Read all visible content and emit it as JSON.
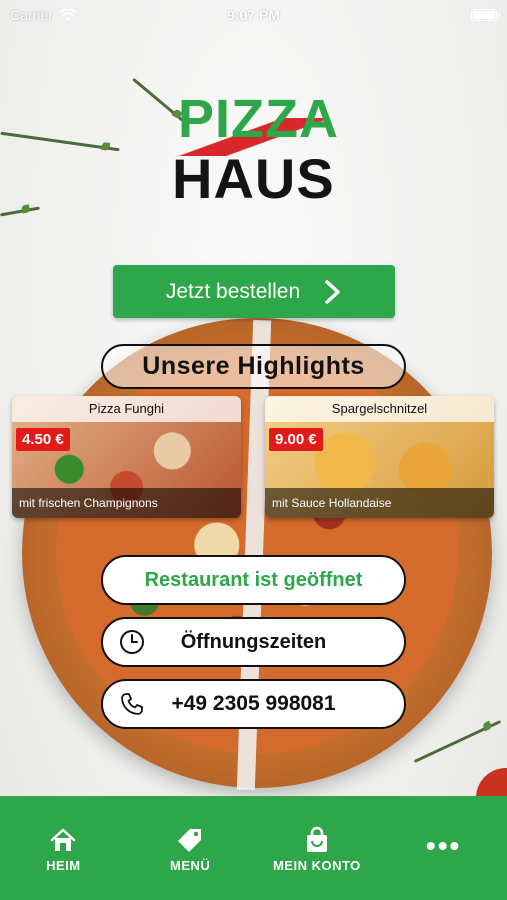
{
  "status_bar": {
    "carrier": "Carrier",
    "time": "9:07 PM"
  },
  "logo": {
    "line1": "PIZZA",
    "line2": "HAUS"
  },
  "order_button": {
    "label": "Jetzt bestellen"
  },
  "highlights": {
    "heading": "Unsere Highlights",
    "items": [
      {
        "title": "Pizza Funghi",
        "price": "4.50 €",
        "description": "mit frischen Champignons"
      },
      {
        "title": "Spargelschnitzel",
        "price": "9.00 €",
        "description": "mit Sauce Hollandaise"
      }
    ]
  },
  "info": {
    "status": "Restaurant ist geöffnet",
    "hours": "Öffnungszeiten",
    "phone": "+49 2305 998081"
  },
  "nav": {
    "items": [
      {
        "label": "HEIM",
        "icon": "home-icon"
      },
      {
        "label": "MENÜ",
        "icon": "tag-icon"
      },
      {
        "label": "MEIN KONTO",
        "icon": "shopping-bag-icon"
      },
      {
        "label": "",
        "icon": "more-icon"
      }
    ]
  },
  "colors": {
    "brand_green": "#2ea64a",
    "price_red": "#e31a1a",
    "logo_red": "#d8282a"
  }
}
